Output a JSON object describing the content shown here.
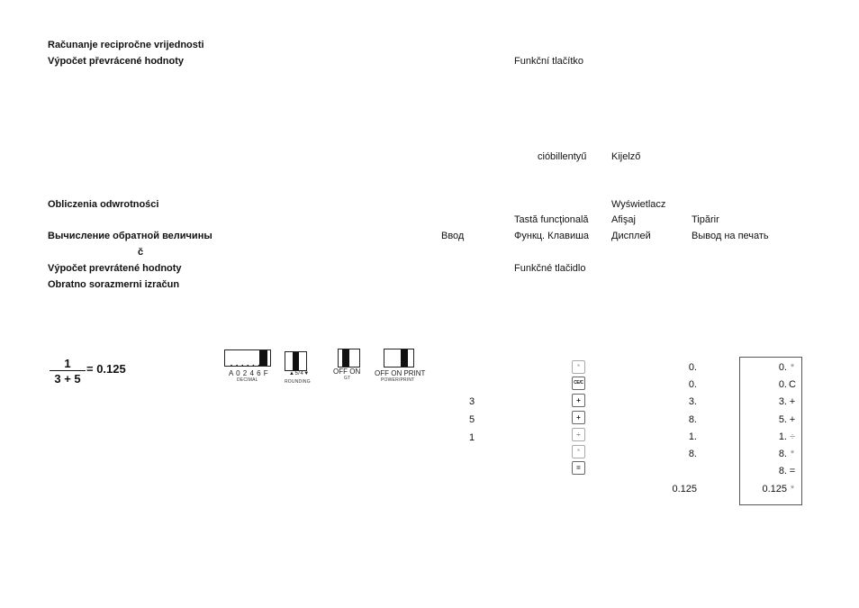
{
  "headings": {
    "croatian": "Računanje recipročne vrijednosti",
    "czech": "Výpočet převrácené hodnoty",
    "polish": "Obliczenia odwrotności",
    "russian": "Вычисление обратной величины",
    "stray_char": "č",
    "slovak": "Výpočet prevrátené hodnoty",
    "slovenian": "Obratno sorazmerni izračun"
  },
  "column_labels": {
    "czech_function_key": "Funkční tlačítko",
    "hungarian_function_key": "cióbillentyű",
    "hungarian_display": "Kijelző",
    "polish_display": "Wyświetlacz",
    "romanian_function_key": "Tastă funcţională",
    "romanian_display": "Afişaj",
    "romanian_print": "Tipărir",
    "russian_entry": "Ввод",
    "russian_function_key": "Функц. Клавиша",
    "russian_display": "Дисплей",
    "russian_print": "Вывод на печать",
    "slovak_function_key": "Funkčné tlačidlo"
  },
  "formula": {
    "numerator": "1",
    "denominator": "3 + 5",
    "result": "= 0.125"
  },
  "switches": {
    "decimal": {
      "positions": "A 0 2 4 6 F",
      "caption": "DECIMAL",
      "selected": "F"
    },
    "rounding": {
      "positions": "▲5/4▼",
      "caption": "ROUNDING",
      "selected": "5/4"
    },
    "gt": {
      "positions": "OFF ON",
      "caption": "GT",
      "selected": "OFF"
    },
    "power_print": {
      "positions": "OFF  ON  PRINT",
      "caption": "POWER/PRINT",
      "selected": "PRINT"
    }
  },
  "steps": [
    {
      "entry": "",
      "key": "*",
      "display": "0.",
      "tape_value": "0.",
      "tape_symbol": "*"
    },
    {
      "entry": "",
      "key": "CE/C",
      "display": "0.",
      "tape_value": "0.",
      "tape_symbol": "C"
    },
    {
      "entry": "3",
      "key": "+",
      "display": "3.",
      "tape_value": "3.",
      "tape_symbol": "+"
    },
    {
      "entry": "5",
      "key": "+",
      "display": "8.",
      "tape_value": "5.",
      "tape_symbol": "+"
    },
    {
      "entry": "1",
      "key": "÷",
      "display": "1.",
      "tape_value": "1.",
      "tape_symbol": "÷"
    },
    {
      "entry": "",
      "key": "*",
      "display": "8.",
      "tape_value": "8.",
      "tape_symbol": "*"
    },
    {
      "entry": "",
      "key": "=",
      "display": "",
      "tape_value": "8.",
      "tape_symbol": "="
    },
    {
      "entry": "",
      "key": "",
      "display": "0.125",
      "tape_value": "0.125",
      "tape_symbol": "*"
    }
  ]
}
